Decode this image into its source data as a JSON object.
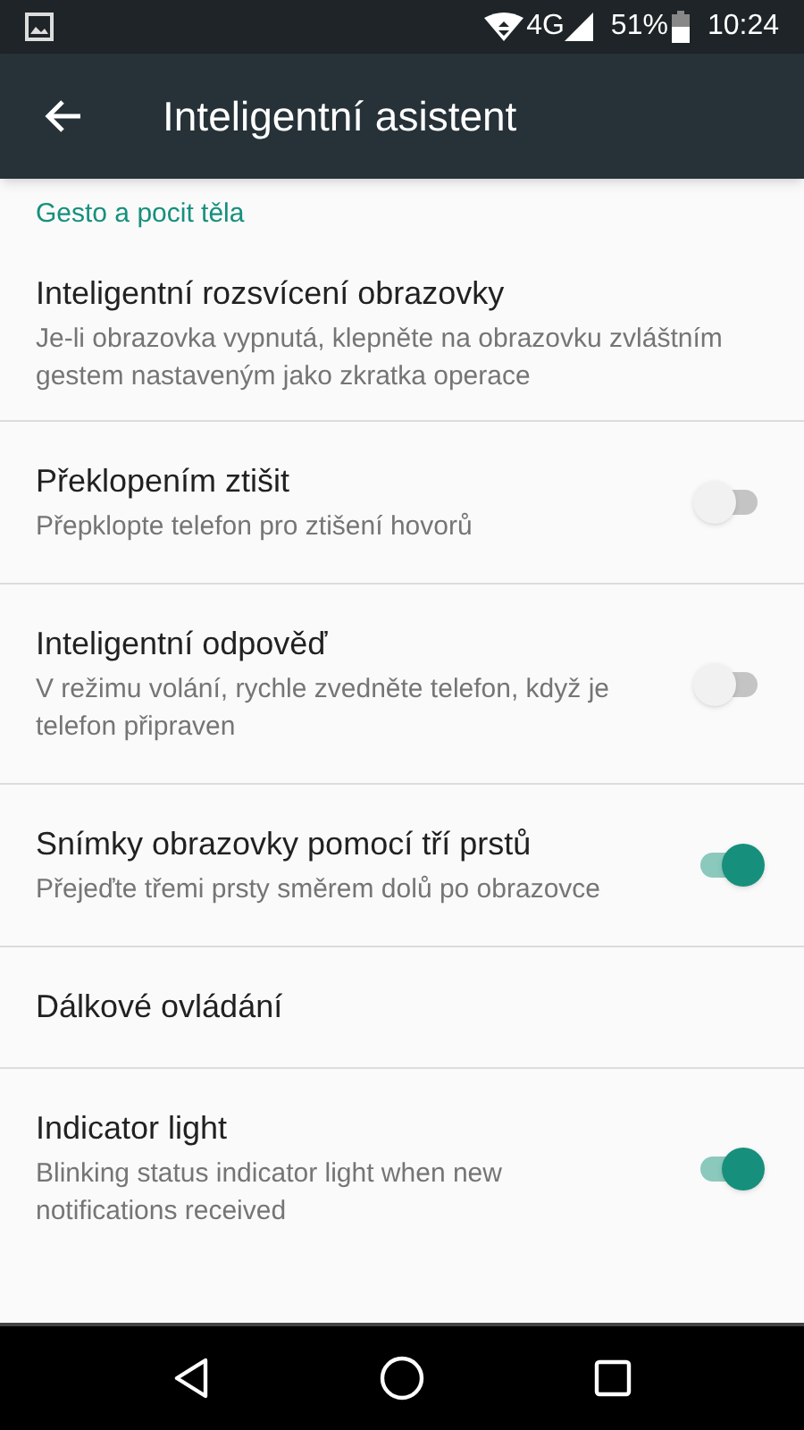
{
  "status_bar": {
    "network": "4G",
    "battery": "51%",
    "time": "10:24"
  },
  "app_bar": {
    "title": "Inteligentní asistent"
  },
  "section": {
    "title": "Gesto a pocit těla"
  },
  "items": [
    {
      "kind": "plain",
      "title": "Inteligentní rozsvícení obrazovky",
      "subtitle": "Je-li obrazovka vypnutá, klepněte na obrazovku zvláštním gestem nastaveným jako zkratka operace"
    },
    {
      "kind": "switch",
      "title": "Překlopením ztišit",
      "subtitle": "Přepklopte telefon pro ztišení hovorů",
      "on": false
    },
    {
      "kind": "switch",
      "title": "Inteligentní odpověď",
      "subtitle": "V režimu volání, rychle zvedněte telefon, když je telefon připraven",
      "on": false
    },
    {
      "kind": "switch",
      "title": "Snímky obrazovky pomocí tří prstů",
      "subtitle": "Přejeďte třemi prsty směrem dolů po obrazovce",
      "on": true
    },
    {
      "kind": "plain",
      "title": "Dálkové ovládání"
    },
    {
      "kind": "switch",
      "title": "Indicator light",
      "subtitle": "Blinking status indicator light when new notifications received",
      "on": true
    }
  ]
}
